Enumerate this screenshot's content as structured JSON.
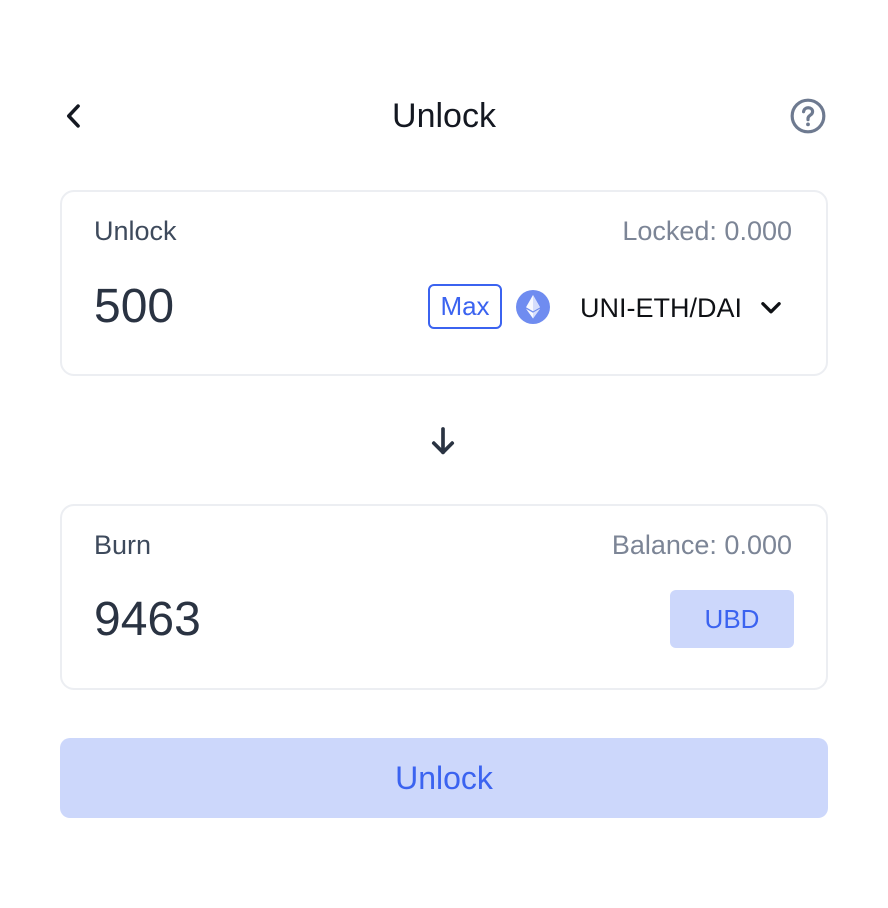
{
  "header": {
    "title": "Unlock",
    "back_icon": "chevron-left-icon",
    "help_icon": "question-circle-icon"
  },
  "unlock_card": {
    "label": "Unlock",
    "meta": "Locked: 0.000",
    "amount": "500",
    "max_label": "Max",
    "token_icon": "ethereum-icon",
    "token_name": "UNI-ETH/DAI",
    "dropdown_icon": "chevron-down-icon"
  },
  "arrow_icon": "arrow-down-icon",
  "burn_card": {
    "label": "Burn",
    "meta": "Balance: 0.000",
    "amount": "9463",
    "token_label": "UBD"
  },
  "submit": {
    "label": "Unlock"
  },
  "colors": {
    "accent": "#3b63f0",
    "accent_light": "#ccd7fb",
    "text_dark": "#141821",
    "text_muted": "#7c8596",
    "card_border": "#eceef2"
  }
}
